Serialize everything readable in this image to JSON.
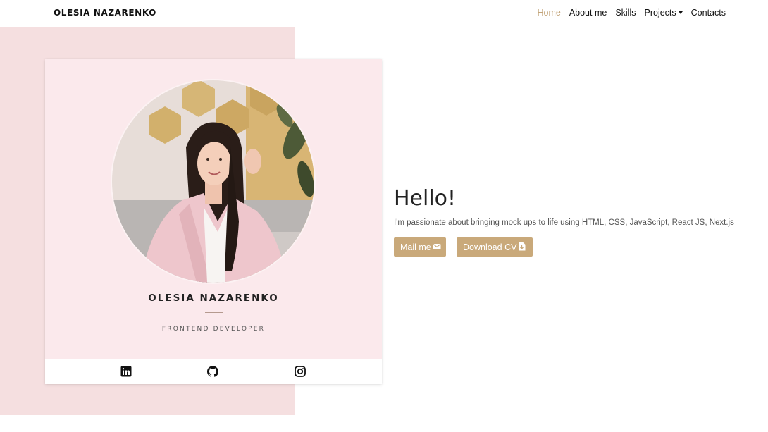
{
  "nav": {
    "brand": "OLESIA NAZARENKO",
    "links": [
      "Home",
      "About me",
      "Skills",
      "Projects",
      "Contacts"
    ],
    "active": "Home"
  },
  "card": {
    "name": "OLESIA NAZARENKO",
    "role": "FRONTEND DEVELOPER",
    "social": [
      "linkedin-icon",
      "github-icon",
      "instagram-icon"
    ]
  },
  "hero": {
    "greeting": "Hello!",
    "tagline": "I'm passionate about bringing mock ups to life using HTML, CSS, JavaScript, React JS, Next.js",
    "mail_label": "Mail me",
    "cv_label": "Download CV"
  },
  "colors": {
    "accent": "#c9a97a",
    "panel_bg": "#f5dfe0",
    "card_bg": "#fbe9ec"
  }
}
